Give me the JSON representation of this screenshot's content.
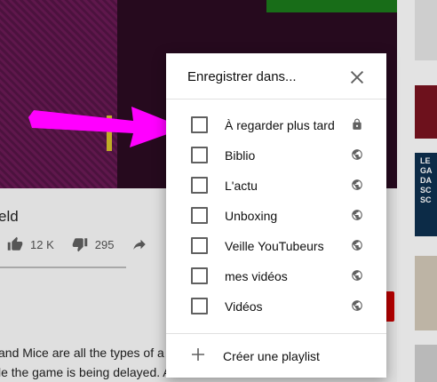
{
  "background": {
    "video_title": "eld",
    "likes": "12 K",
    "dislikes": "295",
    "description_lines": [
      "and Mice are all the types of a",
      "le the game is being delayed. A"
    ],
    "right_thumb_texts": [
      "LE",
      "GA",
      "DA",
      "SC",
      "SC"
    ]
  },
  "dialog": {
    "title": "Enregistrer dans...",
    "playlists": [
      {
        "label": "À regarder plus tard",
        "icon": "lock-icon",
        "checked": false
      },
      {
        "label": "Biblio",
        "icon": "globe-icon",
        "checked": false
      },
      {
        "label": "L'actu",
        "icon": "globe-icon",
        "checked": false
      },
      {
        "label": "Unboxing",
        "icon": "globe-icon",
        "checked": false
      },
      {
        "label": "Veille YouTubeurs",
        "icon": "globe-icon",
        "checked": false
      },
      {
        "label": "mes vidéos",
        "icon": "globe-icon",
        "checked": false
      },
      {
        "label": "Vidéos",
        "icon": "globe-icon",
        "checked": false
      }
    ],
    "create_label": "Créer une playlist"
  },
  "colors": {
    "annotation_arrow": "#ff00ff",
    "icon_gray": "#606060",
    "subscribe_red": "#cc0000"
  }
}
